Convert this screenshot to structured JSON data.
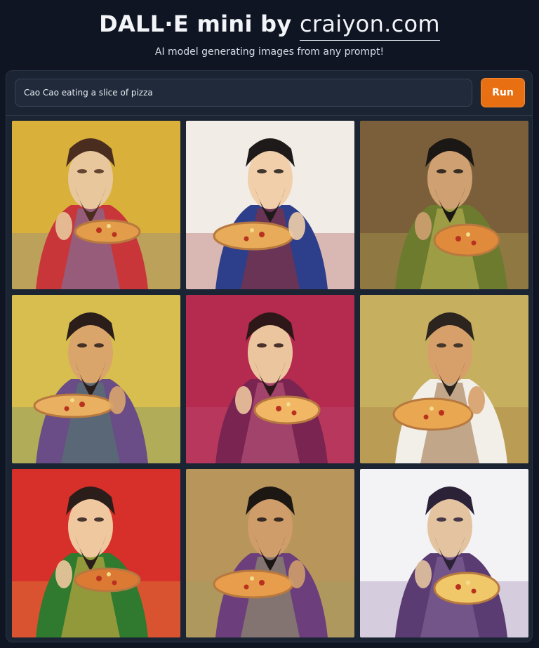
{
  "header": {
    "title_prefix": "DALL·E mini by",
    "title_link": "craiyon.com",
    "subtitle": "AI model generating images from any prompt!"
  },
  "prompt": {
    "value": "Cao Cao eating a slice of pizza",
    "run_label": "Run"
  },
  "images": [
    {
      "bg": "#d9b13a",
      "robe": "#c9363a",
      "accent": "#6f7bb0",
      "face": "#e7c79b",
      "hair": "#4a2d1e",
      "pizza": "#e39d4a"
    },
    {
      "bg": "#f1ede6",
      "robe": "#2d3f8a",
      "accent": "#9a2b2b",
      "face": "#f1cfaa",
      "hair": "#1f1a1a",
      "pizza": "#e7ab59"
    },
    {
      "bg": "#7b5f3a",
      "robe": "#6c7b2e",
      "accent": "#c7b95a",
      "face": "#cfa071",
      "hair": "#1a1715",
      "pizza": "#e08a3b"
    },
    {
      "bg": "#d7be4f",
      "robe": "#6a4c86",
      "accent": "#4d7d6c",
      "face": "#d9a56b",
      "hair": "#2a1d1a",
      "pizza": "#eab061"
    },
    {
      "bg": "#b52a4f",
      "robe": "#7a2452",
      "accent": "#c35c82",
      "face": "#ebc59d",
      "hair": "#2e1719",
      "pizza": "#f2b765"
    },
    {
      "bg": "#c7af60",
      "robe": "#f1efe8",
      "accent": "#9a6a3a",
      "face": "#d7a06a",
      "hair": "#2b241f",
      "pizza": "#e8a750"
    },
    {
      "bg": "#d72f2a",
      "robe": "#2f7a2e",
      "accent": "#e1b346",
      "face": "#f0c8a0",
      "hair": "#2a1d1a",
      "pizza": "#dc7a34"
    },
    {
      "bg": "#b8955a",
      "robe": "#6c3f7c",
      "accent": "#98a167",
      "face": "#cf9d6a",
      "hair": "#1d1714",
      "pizza": "#e79d4b"
    },
    {
      "bg": "#f3f2f5",
      "robe": "#5a3c73",
      "accent": "#8a6a9d",
      "face": "#e3c3a0",
      "hair": "#2c2238",
      "pizza": "#f0c86a"
    }
  ]
}
